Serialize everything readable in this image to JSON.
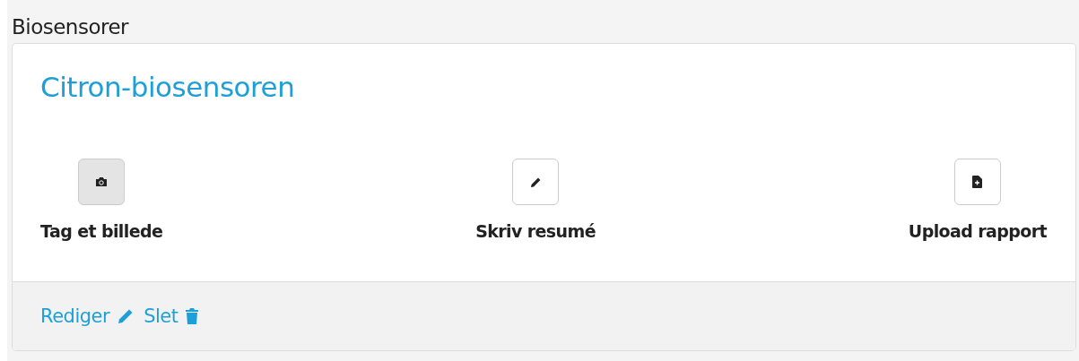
{
  "section_title": "Biosensorer",
  "card": {
    "title": "Citron-biosensoren",
    "actions": [
      {
        "kind": "camera",
        "label": "Tag et billede",
        "selected": true
      },
      {
        "kind": "pencil",
        "label": "Skriv resumé",
        "selected": false
      },
      {
        "kind": "file-add",
        "label": "Upload rapport",
        "selected": false
      }
    ],
    "footer_links": [
      {
        "kind": "pencil",
        "label": "Rediger"
      },
      {
        "kind": "trash",
        "label": "Slet"
      }
    ]
  }
}
